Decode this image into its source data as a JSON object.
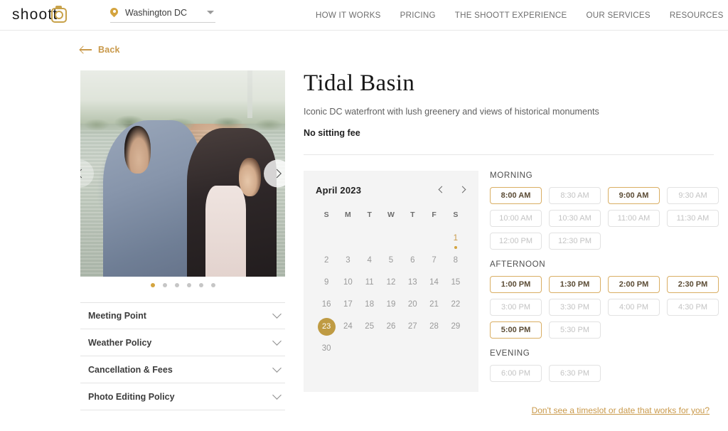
{
  "header": {
    "logo_text": "shoott",
    "logo_icon": "camera-icon",
    "location": {
      "icon": "map-pin-icon",
      "value": "Washington DC",
      "caret": "chevron-down-icon"
    },
    "nav": [
      {
        "label": "HOW IT WORKS"
      },
      {
        "label": "PRICING"
      },
      {
        "label": "THE SHOOTT EXPERIENCE"
      },
      {
        "label": "OUR SERVICES"
      },
      {
        "label": "RESOURCES"
      }
    ]
  },
  "back": {
    "icon": "arrow-left-icon",
    "label": "Back"
  },
  "gallery": {
    "prev_icon": "chevron-left-icon",
    "next_icon": "chevron-right-icon",
    "dot_count": 6,
    "active_dot": 0
  },
  "accordion": [
    {
      "label": "Meeting Point",
      "icon": "chevron-down-icon"
    },
    {
      "label": "Weather Policy",
      "icon": "chevron-down-icon"
    },
    {
      "label": "Cancellation & Fees",
      "icon": "chevron-down-icon"
    },
    {
      "label": "Photo Editing Policy",
      "icon": "chevron-down-icon"
    }
  ],
  "listing": {
    "title": "Tidal Basin",
    "subtitle": "Iconic DC waterfront with lush greenery and views of historical monuments",
    "fee": "No sitting fee"
  },
  "calendar": {
    "month_label": "April 2023",
    "prev_icon": "chevron-left-icon",
    "next_icon": "chevron-right-icon",
    "dow": [
      "S",
      "M",
      "T",
      "W",
      "T",
      "F",
      "S"
    ],
    "leading_blanks": 6,
    "days": [
      {
        "n": "1",
        "state": "available"
      },
      {
        "n": "2",
        "state": "disabled"
      },
      {
        "n": "3",
        "state": "disabled"
      },
      {
        "n": "4",
        "state": "disabled"
      },
      {
        "n": "5",
        "state": "disabled"
      },
      {
        "n": "6",
        "state": "disabled"
      },
      {
        "n": "7",
        "state": "disabled"
      },
      {
        "n": "8",
        "state": "disabled"
      },
      {
        "n": "9",
        "state": "disabled"
      },
      {
        "n": "10",
        "state": "disabled"
      },
      {
        "n": "11",
        "state": "disabled"
      },
      {
        "n": "12",
        "state": "disabled"
      },
      {
        "n": "13",
        "state": "disabled"
      },
      {
        "n": "14",
        "state": "disabled"
      },
      {
        "n": "15",
        "state": "disabled"
      },
      {
        "n": "16",
        "state": "disabled"
      },
      {
        "n": "17",
        "state": "disabled"
      },
      {
        "n": "18",
        "state": "disabled"
      },
      {
        "n": "19",
        "state": "disabled"
      },
      {
        "n": "20",
        "state": "disabled"
      },
      {
        "n": "21",
        "state": "disabled"
      },
      {
        "n": "22",
        "state": "disabled"
      },
      {
        "n": "23",
        "state": "selected"
      },
      {
        "n": "24",
        "state": "disabled"
      },
      {
        "n": "25",
        "state": "disabled"
      },
      {
        "n": "26",
        "state": "disabled"
      },
      {
        "n": "27",
        "state": "disabled"
      },
      {
        "n": "28",
        "state": "disabled"
      },
      {
        "n": "29",
        "state": "disabled"
      },
      {
        "n": "30",
        "state": "disabled"
      }
    ]
  },
  "timeslots": [
    {
      "title": "MORNING",
      "slots": [
        {
          "label": "8:00 AM",
          "state": "available"
        },
        {
          "label": "8:30 AM",
          "state": "disabled"
        },
        {
          "label": "9:00 AM",
          "state": "available"
        },
        {
          "label": "9:30 AM",
          "state": "disabled"
        },
        {
          "label": "10:00 AM",
          "state": "disabled"
        },
        {
          "label": "10:30 AM",
          "state": "disabled"
        },
        {
          "label": "11:00 AM",
          "state": "disabled"
        },
        {
          "label": "11:30 AM",
          "state": "disabled"
        },
        {
          "label": "12:00 PM",
          "state": "disabled"
        },
        {
          "label": "12:30 PM",
          "state": "disabled"
        }
      ]
    },
    {
      "title": "AFTERNOON",
      "slots": [
        {
          "label": "1:00 PM",
          "state": "available"
        },
        {
          "label": "1:30 PM",
          "state": "available"
        },
        {
          "label": "2:00 PM",
          "state": "available"
        },
        {
          "label": "2:30 PM",
          "state": "available"
        },
        {
          "label": "3:00 PM",
          "state": "disabled"
        },
        {
          "label": "3:30 PM",
          "state": "disabled"
        },
        {
          "label": "4:00 PM",
          "state": "disabled"
        },
        {
          "label": "4:30 PM",
          "state": "disabled"
        },
        {
          "label": "5:00 PM",
          "state": "available"
        },
        {
          "label": "5:30 PM",
          "state": "disabled"
        }
      ]
    },
    {
      "title": "EVENING",
      "slots": [
        {
          "label": "6:00 PM",
          "state": "disabled"
        },
        {
          "label": "6:30 PM",
          "state": "disabled"
        }
      ]
    }
  ],
  "help_link": "Don't see a timeslot or date that works for you?",
  "colors": {
    "accent_gold": "#c9994a",
    "selected_day": "#bf9b43",
    "slot_border_available": "#d9ae63",
    "panel_bg": "#f4f4f4"
  }
}
